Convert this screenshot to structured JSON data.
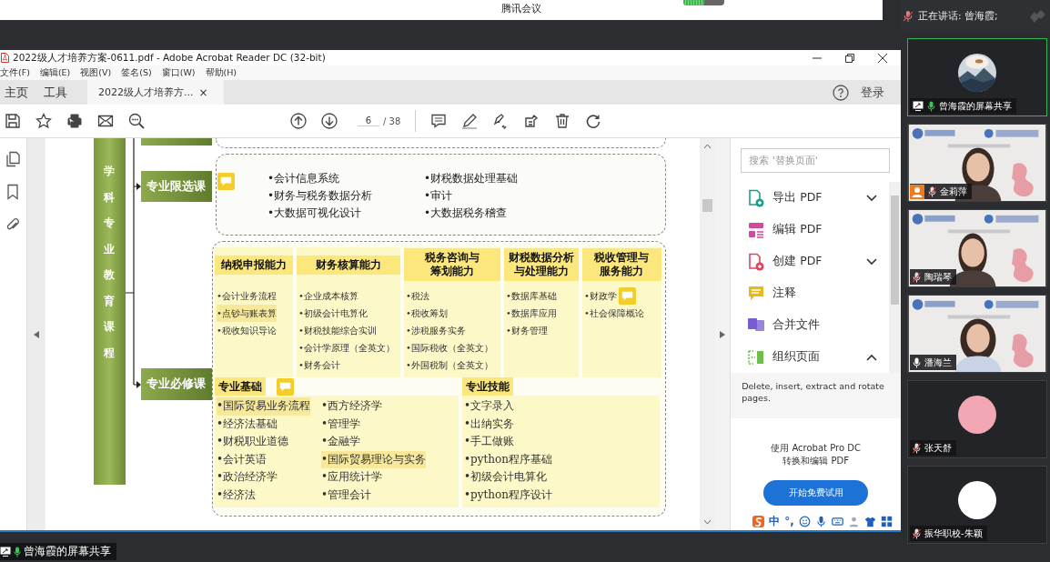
{
  "meeting": {
    "title": "腾讯会议",
    "audio_level": {
      "level": 0.5
    }
  },
  "speaking": {
    "label": "正在讲话: 曾海霞;"
  },
  "acrobat": {
    "window_title": "2022级人才培养方案-0611.pdf - Adobe Acrobat Reader DC (32-bit)",
    "menu": [
      "文件(F)",
      "编辑(E)",
      "视图(V)",
      "签名(S)",
      "窗口(W)",
      "帮助(H)"
    ],
    "tabs": [
      {
        "label": "主页",
        "selected": false
      },
      {
        "label": "工具",
        "selected": false
      },
      {
        "label": "2022级人才培养方...",
        "selected": true,
        "close": "×"
      }
    ],
    "login": "登录",
    "page": {
      "current": "6",
      "total": "/ 38"
    },
    "diagram": {
      "side_label": "学科专业教育课程",
      "elective": {
        "label": "专业限选课",
        "comment": true,
        "columns": [
          [
            "•会计信息系统",
            "•财务与税务数据分析",
            "•大数据可视化设计"
          ],
          [
            "•财税数据处理基础",
            "•审计",
            "•大数据税务稽查"
          ]
        ]
      },
      "required": {
        "label": "专业必修课",
        "abilities": [
          {
            "title": "纳税申报能力",
            "items": [
              {
                "text": "•会计业务流程",
                "highlighted": false
              },
              {
                "text": "•点钞与账表算",
                "highlighted": true
              },
              {
                "text": "•税收知识导论",
                "highlighted": false
              }
            ]
          },
          {
            "title": "财务核算能力",
            "items": [
              {
                "text": "•企业成本核算",
                "highlighted": false
              },
              {
                "text": "•初级会计电算化",
                "highlighted": false
              },
              {
                "text": "•财税技能综合实训",
                "highlighted": false
              },
              {
                "text": "•会计学原理（全英文）",
                "highlighted": false
              },
              {
                "text": "•财务会计",
                "highlighted": false
              }
            ]
          },
          {
            "title": "税务咨询与筹划能力",
            "items": [
              {
                "text": "•税法",
                "highlighted": false
              },
              {
                "text": "•税收筹划",
                "highlighted": false
              },
              {
                "text": "•涉税服务实务",
                "highlighted": false
              },
              {
                "text": "•国际税收（全英文）",
                "highlighted": false
              },
              {
                "text": "•外国税制（全英文）",
                "highlighted": false
              }
            ]
          },
          {
            "title": "财税数据分析与处理能力",
            "items": [
              {
                "text": "•数据库基础",
                "highlighted": false
              },
              {
                "text": "•数据库应用",
                "highlighted": false
              },
              {
                "text": "•财务管理",
                "highlighted": false
              }
            ]
          },
          {
            "title": "税收管理与服务能力",
            "items": [
              {
                "text": "•财政学",
                "highlighted": false,
                "comment": true
              },
              {
                "text": "•社会保障概论",
                "highlighted": false
              }
            ]
          }
        ],
        "sections": [
          {
            "title": "专业基础",
            "comment": true,
            "columns": [
              [
                {
                  "text": "•国际贸易业务流程",
                  "highlighted": true
                },
                {
                  "text": "•经济法基础",
                  "highlighted": false
                },
                {
                  "text": "•财税职业道德",
                  "highlighted": false
                },
                {
                  "text": "•会计英语",
                  "highlighted": false
                },
                {
                  "text": "•政治经济学",
                  "highlighted": false
                },
                {
                  "text": "•经济法",
                  "highlighted": false
                }
              ],
              [
                {
                  "text": "•西方经济学",
                  "highlighted": false
                },
                {
                  "text": "•管理学",
                  "highlighted": false
                },
                {
                  "text": "•金融学",
                  "highlighted": false
                },
                {
                  "text": "•国际贸易理论与实务",
                  "highlighted": true
                },
                {
                  "text": "•应用统计学",
                  "highlighted": false
                },
                {
                  "text": "•管理会计",
                  "highlighted": false
                }
              ]
            ]
          },
          {
            "title": "专业技能",
            "comment": false,
            "columns": [
              [
                {
                  "text": "•文字录入",
                  "highlighted": false
                },
                {
                  "text": "•出纳实务",
                  "highlighted": false
                },
                {
                  "text": "•手工做账",
                  "highlighted": false
                },
                {
                  "text": "•python程序基础",
                  "highlighted": false
                },
                {
                  "text": "•初级会计电算化",
                  "highlighted": false
                },
                {
                  "text": "•python程序设计",
                  "highlighted": false
                }
              ]
            ]
          }
        ]
      }
    },
    "tools_panel": {
      "search_placeholder": "搜索 '替换页面'",
      "tools": [
        {
          "label": "导出 PDF",
          "kind": "export",
          "color": "#1b9e8a",
          "expanded": false
        },
        {
          "label": "编辑 PDF",
          "kind": "edit",
          "color": "#d04aa0"
        },
        {
          "label": "创建 PDF",
          "kind": "create",
          "color": "#e0445a",
          "expanded": false
        },
        {
          "label": "注释",
          "kind": "comment",
          "color": "#e8b81c"
        },
        {
          "label": "合并文件",
          "kind": "combine",
          "color": "#7a5bd6"
        },
        {
          "label": "组织页面",
          "kind": "organize",
          "color": "#6cbf4a",
          "expanded": true
        }
      ],
      "description": "Delete, insert, extract and rotate pages.",
      "promo": [
        "使用 Acrobat Pro DC",
        "转换和编辑 PDF"
      ],
      "trial_button": "开始免费试用",
      "ime": {
        "lang": "中",
        "punct": "°,"
      }
    }
  },
  "participants": [
    {
      "name": "曾海霞的屏幕共享",
      "kind": "share",
      "muted": false,
      "speaking": true,
      "host": false
    },
    {
      "name": "金莉萍",
      "kind": "video",
      "muted": true,
      "speaking": false,
      "host": true
    },
    {
      "name": "陶瑞琴",
      "kind": "video",
      "muted": true,
      "speaking": false,
      "host": false
    },
    {
      "name": "潘海兰",
      "kind": "video",
      "muted": false,
      "speaking": false,
      "host": false
    },
    {
      "name": "张天舒",
      "kind": "avatar",
      "color": "#f2a7b4",
      "muted": true,
      "speaking": false,
      "host": false
    },
    {
      "name": "振华职校-朱颖",
      "kind": "avatar",
      "color": "#ffffff",
      "muted": true,
      "speaking": false,
      "host": false
    }
  ],
  "share_bar": {
    "label": "曾海霞的屏幕共享",
    "muted": false
  }
}
